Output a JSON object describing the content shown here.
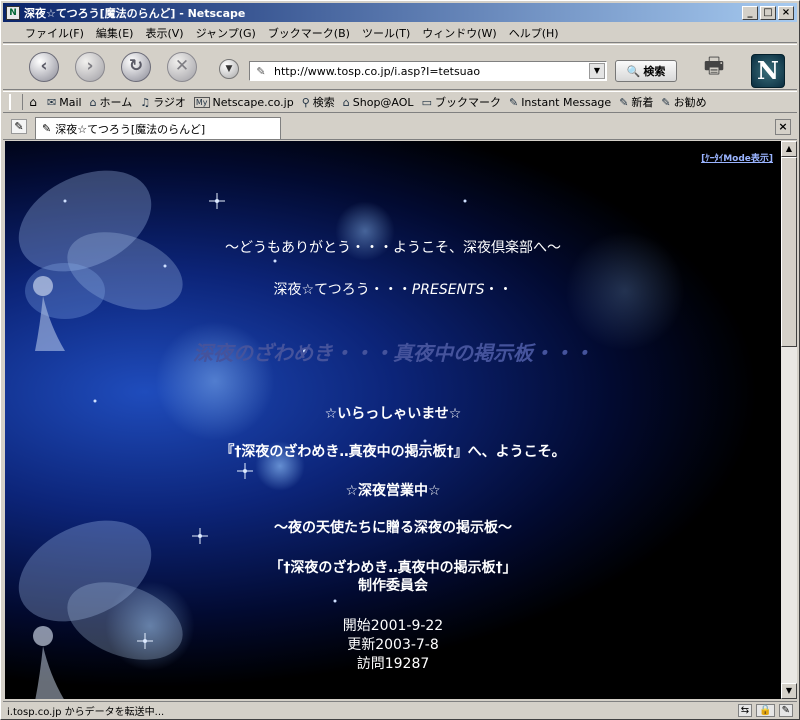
{
  "window": {
    "title": "深夜☆てつろう[魔法のらんど] - Netscape",
    "controls": {
      "minimize": "_",
      "maximize": "□",
      "close": "×"
    }
  },
  "menubar": {
    "items": [
      "ファイル(F)",
      "編集(E)",
      "表示(V)",
      "ジャンプ(G)",
      "ブックマーク(B)",
      "ツール(T)",
      "ウィンドウ(W)",
      "ヘルプ(H)"
    ]
  },
  "navbar": {
    "url": "http://www.tosp.co.jp/i.asp?I=tetsuao",
    "search_label": "検索"
  },
  "bookmarks": {
    "items": [
      {
        "icon": "mail-icon",
        "label": "Mail"
      },
      {
        "icon": "home-icon",
        "label": "ホーム"
      },
      {
        "icon": "radio-icon",
        "label": "ラジオ"
      },
      {
        "icon": "my-icon",
        "label": "Netscape.co.jp"
      },
      {
        "icon": "search-icon",
        "label": "検索"
      },
      {
        "icon": "shop-icon",
        "label": "Shop@AOL"
      },
      {
        "icon": "folder-icon",
        "label": "ブックマーク"
      },
      {
        "icon": "bookmark-icon",
        "label": "Instant Message"
      },
      {
        "icon": "bookmark-icon",
        "label": "新着"
      },
      {
        "icon": "bookmark-icon",
        "label": "お勧め"
      }
    ]
  },
  "tab": {
    "label": "深夜☆てつろう[魔法のらんど]"
  },
  "page": {
    "ktai_link": "[ｹｰﾀｲMode表示]",
    "greeting": "～どうもありがとう・・・ようこそ、深夜倶楽部へ～",
    "presents_prefix": "深夜☆てつろう・・・",
    "presents_word": "PRESENTS",
    "presents_suffix": "・・",
    "big_title": "深夜のざわめき・・・真夜中の掲示板・・・",
    "welcome": "☆いらっしゃいませ☆",
    "board_welcome": "『†深夜のざわめき‥真夜中の掲示板†』へ、ようこそ。",
    "open_status": "☆深夜営業中☆",
    "tagline": "～夜の天使たちに贈る深夜の掲示板～",
    "committee_line1": "「†深夜のざわめき‥真夜中の掲示板†」",
    "committee_line2": "制作委員会",
    "started": "開始2001-9-22",
    "updated": "更新2003-7-8",
    "visits": "訪問19287"
  },
  "statusbar": {
    "text": "i.tosp.co.jp からデータを転送中..."
  },
  "colors": {
    "titlebar_start": "#0a246a",
    "titlebar_end": "#a6caf0",
    "page_bg": "#000000",
    "title_faded": "#45539c",
    "link": "#9ab4ff"
  }
}
